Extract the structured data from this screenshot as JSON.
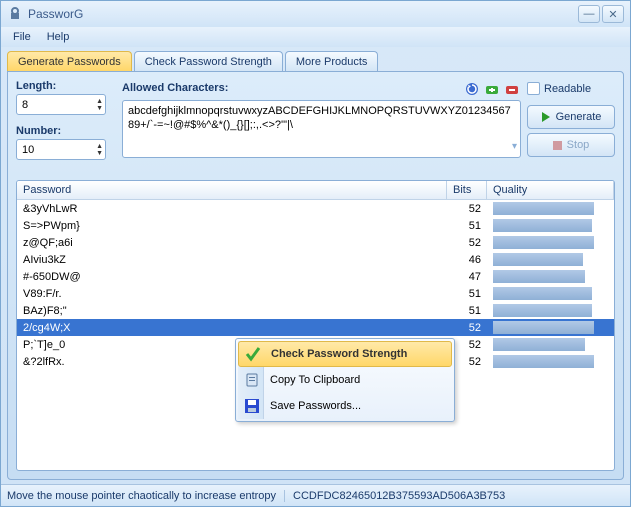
{
  "title": "PassworG",
  "menu": {
    "file": "File",
    "help": "Help"
  },
  "tabs": {
    "gen": "Generate Passwords",
    "check": "Check Password Strength",
    "more": "More Products"
  },
  "labels": {
    "length": "Length:",
    "number": "Number:",
    "allowed": "Allowed Characters:"
  },
  "values": {
    "length": "8",
    "number": "10"
  },
  "allowed_chars": "abcdefghijklmnopqrstuvwxyzABCDEFGHIJKLMNOPQRSTUVWXYZ0123456789+/`-=~!@#$%^&*()_{}[];:,.<>?'\"|\\",
  "buttons": {
    "readable": "Readable",
    "generate": "Generate",
    "stop": "Stop"
  },
  "headers": {
    "password": "Password",
    "bits": "Bits",
    "quality": "Quality"
  },
  "rows": [
    {
      "pwd": "&3yVhLwR",
      "bits": "52",
      "q": 88
    },
    {
      "pwd": "S=>PWpm}",
      "bits": "51",
      "q": 86
    },
    {
      "pwd": "z@QF;a6i",
      "bits": "52",
      "q": 88
    },
    {
      "pwd": "AIviu3kZ",
      "bits": "46",
      "q": 78
    },
    {
      "pwd": "#-650DW@",
      "bits": "47",
      "q": 80
    },
    {
      "pwd": "V89:F/r.",
      "bits": "51",
      "q": 86
    },
    {
      "pwd": "BAz)F8;\"",
      "bits": "51",
      "q": 86
    },
    {
      "pwd": "2/cg4W;X",
      "bits": "52",
      "q": 88,
      "sel": true
    },
    {
      "pwd": "P;`T]e_0",
      "bits": "52",
      "q": 80
    },
    {
      "pwd": "&?2lfRx.",
      "bits": "52",
      "q": 88
    }
  ],
  "context": {
    "check": "Check Password Strength",
    "copy": "Copy To Clipboard",
    "save": "Save Passwords..."
  },
  "status": {
    "msg": "Move the mouse pointer chaotically to increase entropy",
    "hash": "CCDFDC82465012B375593AD506A3B753"
  }
}
